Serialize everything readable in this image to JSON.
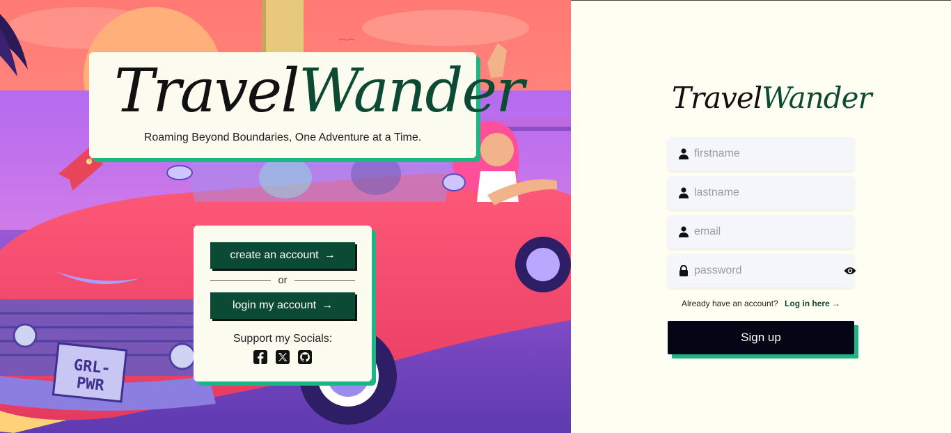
{
  "brand": {
    "logo_part1": "Travel",
    "logo_part2": "Wander",
    "tagline": "Roaming Beyond Boundaries, One Adventure at a Time."
  },
  "hero": {
    "license_plate": "GRL-PWR"
  },
  "actions": {
    "create_label": "create an account",
    "or_label": "or",
    "login_label": "login my account",
    "arrow": "→",
    "support_label": "Support my Socials:",
    "socials": [
      "facebook-icon",
      "x-icon",
      "github-icon"
    ]
  },
  "signup": {
    "logo_part1": "Travel",
    "logo_part2": "Wander",
    "firstname_placeholder": "firstname",
    "lastname_placeholder": "lastname",
    "email_placeholder": "email",
    "password_placeholder": "password",
    "have_account_text": "Already have an account?",
    "login_link": "Log in here →",
    "submit_label": "Sign up"
  },
  "colors": {
    "brand_green": "#0b4a34",
    "accent_green": "#1db584",
    "signup_button": "#040616",
    "right_background": "#fefef2"
  }
}
